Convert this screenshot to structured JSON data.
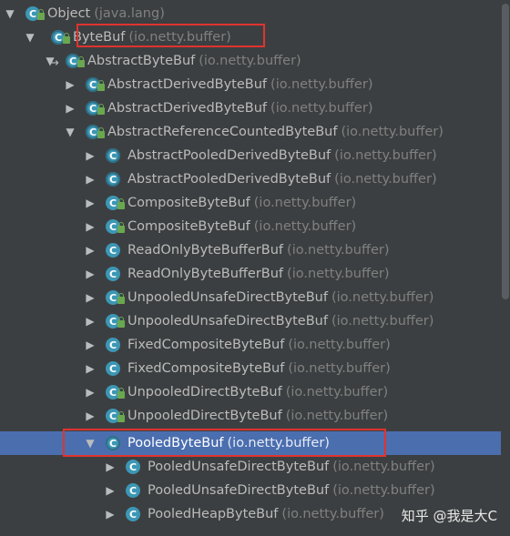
{
  "tree": {
    "rows": [
      {
        "name": "Object",
        "pkg": "(java.lang)",
        "arrow": "▼",
        "icon": "class-icon",
        "lock": true
      },
      {
        "name": "ByteBuf",
        "pkg": "(io.netty.buffer)",
        "arrow": "▼",
        "icon": "abstract-class-icon",
        "lock": true
      },
      {
        "name": "AbstractByteBuf",
        "pkg": "(io.netty.buffer)",
        "arrow": "▼",
        "icon": "abstract-class-icon",
        "lock": true
      },
      {
        "name": "AbstractDerivedByteBuf",
        "pkg": "(io.netty.buffer)",
        "arrow": "▶",
        "icon": "abstract-class-icon",
        "lock": true
      },
      {
        "name": "AbstractDerivedByteBuf",
        "pkg": "(io.netty.buffer)",
        "arrow": "▶",
        "icon": "abstract-class-icon",
        "lock": true
      },
      {
        "name": "AbstractReferenceCountedByteBuf",
        "pkg": "(io.netty.buffer)",
        "arrow": "▼",
        "icon": "abstract-class-icon",
        "lock": true
      },
      {
        "name": "AbstractPooledDerivedByteBuf",
        "pkg": "(io.netty.buffer)",
        "arrow": "▶",
        "icon": "abstract-class-icon",
        "lock": false
      },
      {
        "name": "AbstractPooledDerivedByteBuf",
        "pkg": "(io.netty.buffer)",
        "arrow": "▶",
        "icon": "abstract-class-icon",
        "lock": false
      },
      {
        "name": "CompositeByteBuf",
        "pkg": "(io.netty.buffer)",
        "arrow": "▶",
        "icon": "class-icon",
        "lock": true
      },
      {
        "name": "CompositeByteBuf",
        "pkg": "(io.netty.buffer)",
        "arrow": "▶",
        "icon": "class-icon",
        "lock": true
      },
      {
        "name": "ReadOnlyByteBufferBuf",
        "pkg": "(io.netty.buffer)",
        "arrow": "▶",
        "icon": "class-icon",
        "lock": false
      },
      {
        "name": "ReadOnlyByteBufferBuf",
        "pkg": "(io.netty.buffer)",
        "arrow": "▶",
        "icon": "class-icon",
        "lock": false
      },
      {
        "name": "UnpooledUnsafeDirectByteBuf",
        "pkg": "(io.netty.buffer)",
        "arrow": "▶",
        "icon": "class-icon",
        "lock": true
      },
      {
        "name": "UnpooledUnsafeDirectByteBuf",
        "pkg": "(io.netty.buffer)",
        "arrow": "▶",
        "icon": "class-icon",
        "lock": true
      },
      {
        "name": "FixedCompositeByteBuf",
        "pkg": "(io.netty.buffer)",
        "arrow": "▶",
        "icon": "class-icon",
        "lock": false
      },
      {
        "name": "FixedCompositeByteBuf",
        "pkg": "(io.netty.buffer)",
        "arrow": "▶",
        "icon": "class-icon",
        "lock": false
      },
      {
        "name": "UnpooledDirectByteBuf",
        "pkg": "(io.netty.buffer)",
        "arrow": "▶",
        "icon": "class-icon",
        "lock": true
      },
      {
        "name": "UnpooledDirectByteBuf",
        "pkg": "(io.netty.buffer)",
        "arrow": "▶",
        "icon": "class-icon",
        "lock": true
      },
      {
        "name": "PooledByteBuf",
        "pkg": "(io.netty.buffer)",
        "arrow": "▼",
        "icon": "abstract-class-icon",
        "lock": false
      },
      {
        "name": "PooledUnsafeDirectByteBuf",
        "pkg": "(io.netty.buffer)",
        "arrow": "▶",
        "icon": "class-icon",
        "lock": false
      },
      {
        "name": "PooledUnsafeDirectByteBuf",
        "pkg": "(io.netty.buffer)",
        "arrow": "▶",
        "icon": "class-icon",
        "lock": false
      },
      {
        "name": "PooledHeapByteBuf",
        "pkg": "(io.netty.buffer)",
        "arrow": "▶",
        "icon": "class-icon",
        "lock": false
      }
    ],
    "selected_index": 18,
    "icon_letter": "C"
  },
  "watermark": "知乎 @我是大C",
  "colors": {
    "background": "#3c3f41",
    "selection": "#4b6eaf",
    "highlight_box": "#e0332f",
    "class_icon": "#3c97b5",
    "lock_icon": "#6aa84f"
  }
}
